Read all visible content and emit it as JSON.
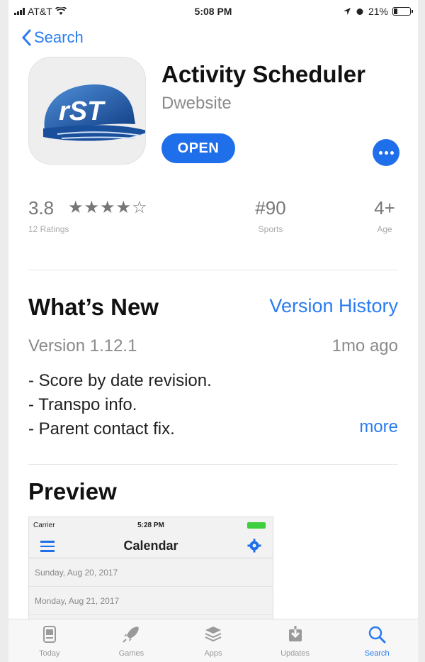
{
  "status_bar": {
    "carrier": "AT&T",
    "time": "5:08 PM",
    "battery": "21%"
  },
  "nav": {
    "back_label": "Search"
  },
  "app": {
    "title": "Activity Scheduler",
    "developer": "Dwebsite",
    "open_label": "OPEN",
    "icon_text": "rST"
  },
  "stats": {
    "rating": "3.8",
    "stars": "★★★★☆",
    "ratings_count": "12 Ratings",
    "rank": "#90",
    "category": "Sports",
    "age": "4+",
    "age_label": "Age"
  },
  "whats_new": {
    "title": "What’s New",
    "history_link": "Version History",
    "version": "Version 1.12.1",
    "time_ago": "1mo ago",
    "notes": [
      "- Score by date revision.",
      "- Transpo info.",
      "- Parent contact fix."
    ],
    "more_label": "more"
  },
  "preview": {
    "title": "Preview",
    "screenshot": {
      "carrier": "Carrier",
      "time": "5:28 PM",
      "nav_title": "Calendar",
      "rows": [
        "Sunday, Aug 20, 2017",
        "Monday, Aug 21, 2017"
      ]
    }
  },
  "tabs": [
    {
      "label": "Today",
      "icon": "today-icon",
      "active": false
    },
    {
      "label": "Games",
      "icon": "rocket-icon",
      "active": false
    },
    {
      "label": "Apps",
      "icon": "layers-icon",
      "active": false
    },
    {
      "label": "Updates",
      "icon": "download-icon",
      "active": false
    },
    {
      "label": "Search",
      "icon": "search-icon",
      "active": true
    }
  ],
  "colors": {
    "accent": "#2a7cf2",
    "button": "#1f6fea",
    "icon_cap": "#1e5aa8"
  }
}
